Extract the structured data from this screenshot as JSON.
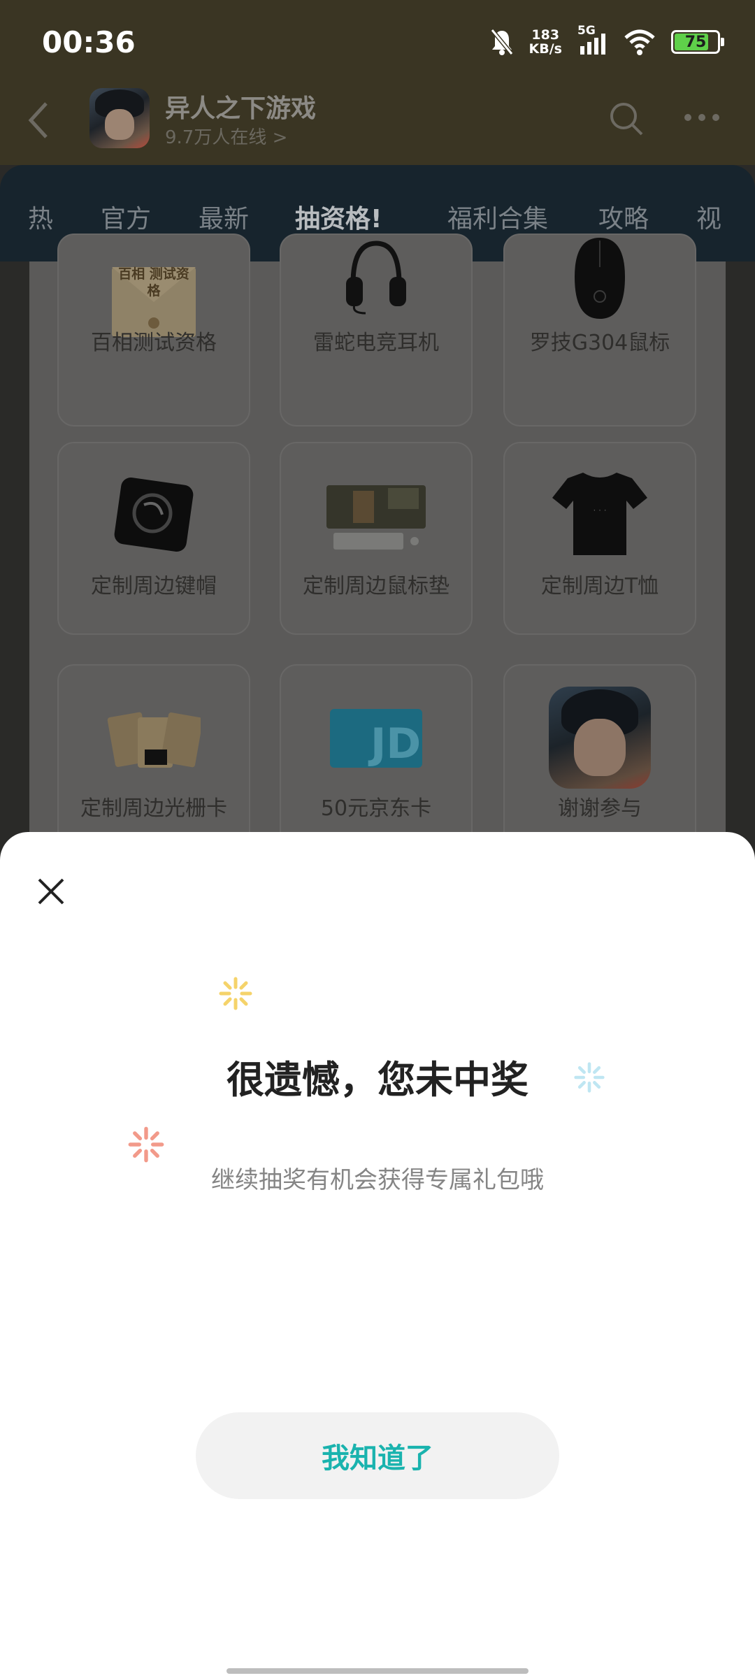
{
  "status_bar": {
    "time": "00:36",
    "net_speed_value": "183",
    "net_speed_unit": "KB/s",
    "network_type": "5G",
    "battery": "75"
  },
  "header": {
    "title": "异人之下游戏",
    "online": "9.7万人在线 >"
  },
  "tabs": [
    {
      "label": "热"
    },
    {
      "label": "官方"
    },
    {
      "label": "最新"
    },
    {
      "label": "抽资格!",
      "active": true
    },
    {
      "label": "福利合集"
    },
    {
      "label": "攻略"
    },
    {
      "label": "视"
    }
  ],
  "prizes": [
    {
      "label": "百相测试资格",
      "thumb_text": "百相 测试资格"
    },
    {
      "label": "雷蛇电竞耳机"
    },
    {
      "label": "罗技G304鼠标"
    },
    {
      "label": "定制周边键帽"
    },
    {
      "label": "定制周边鼠标垫"
    },
    {
      "label": "定制周边T恤"
    },
    {
      "label": "定制周边光栅卡"
    },
    {
      "label": "50元京东卡"
    },
    {
      "label": "谢谢参与"
    }
  ],
  "dialog": {
    "title": "很遗憾，您未中奖",
    "subtitle": "继续抽奖有机会获得专属礼包哦",
    "button_label": "我知道了",
    "accent_color": "#1ab3ae"
  },
  "icons": [
    "back-icon",
    "search-icon",
    "more-icon",
    "close-icon",
    "sparkle-icon"
  ]
}
